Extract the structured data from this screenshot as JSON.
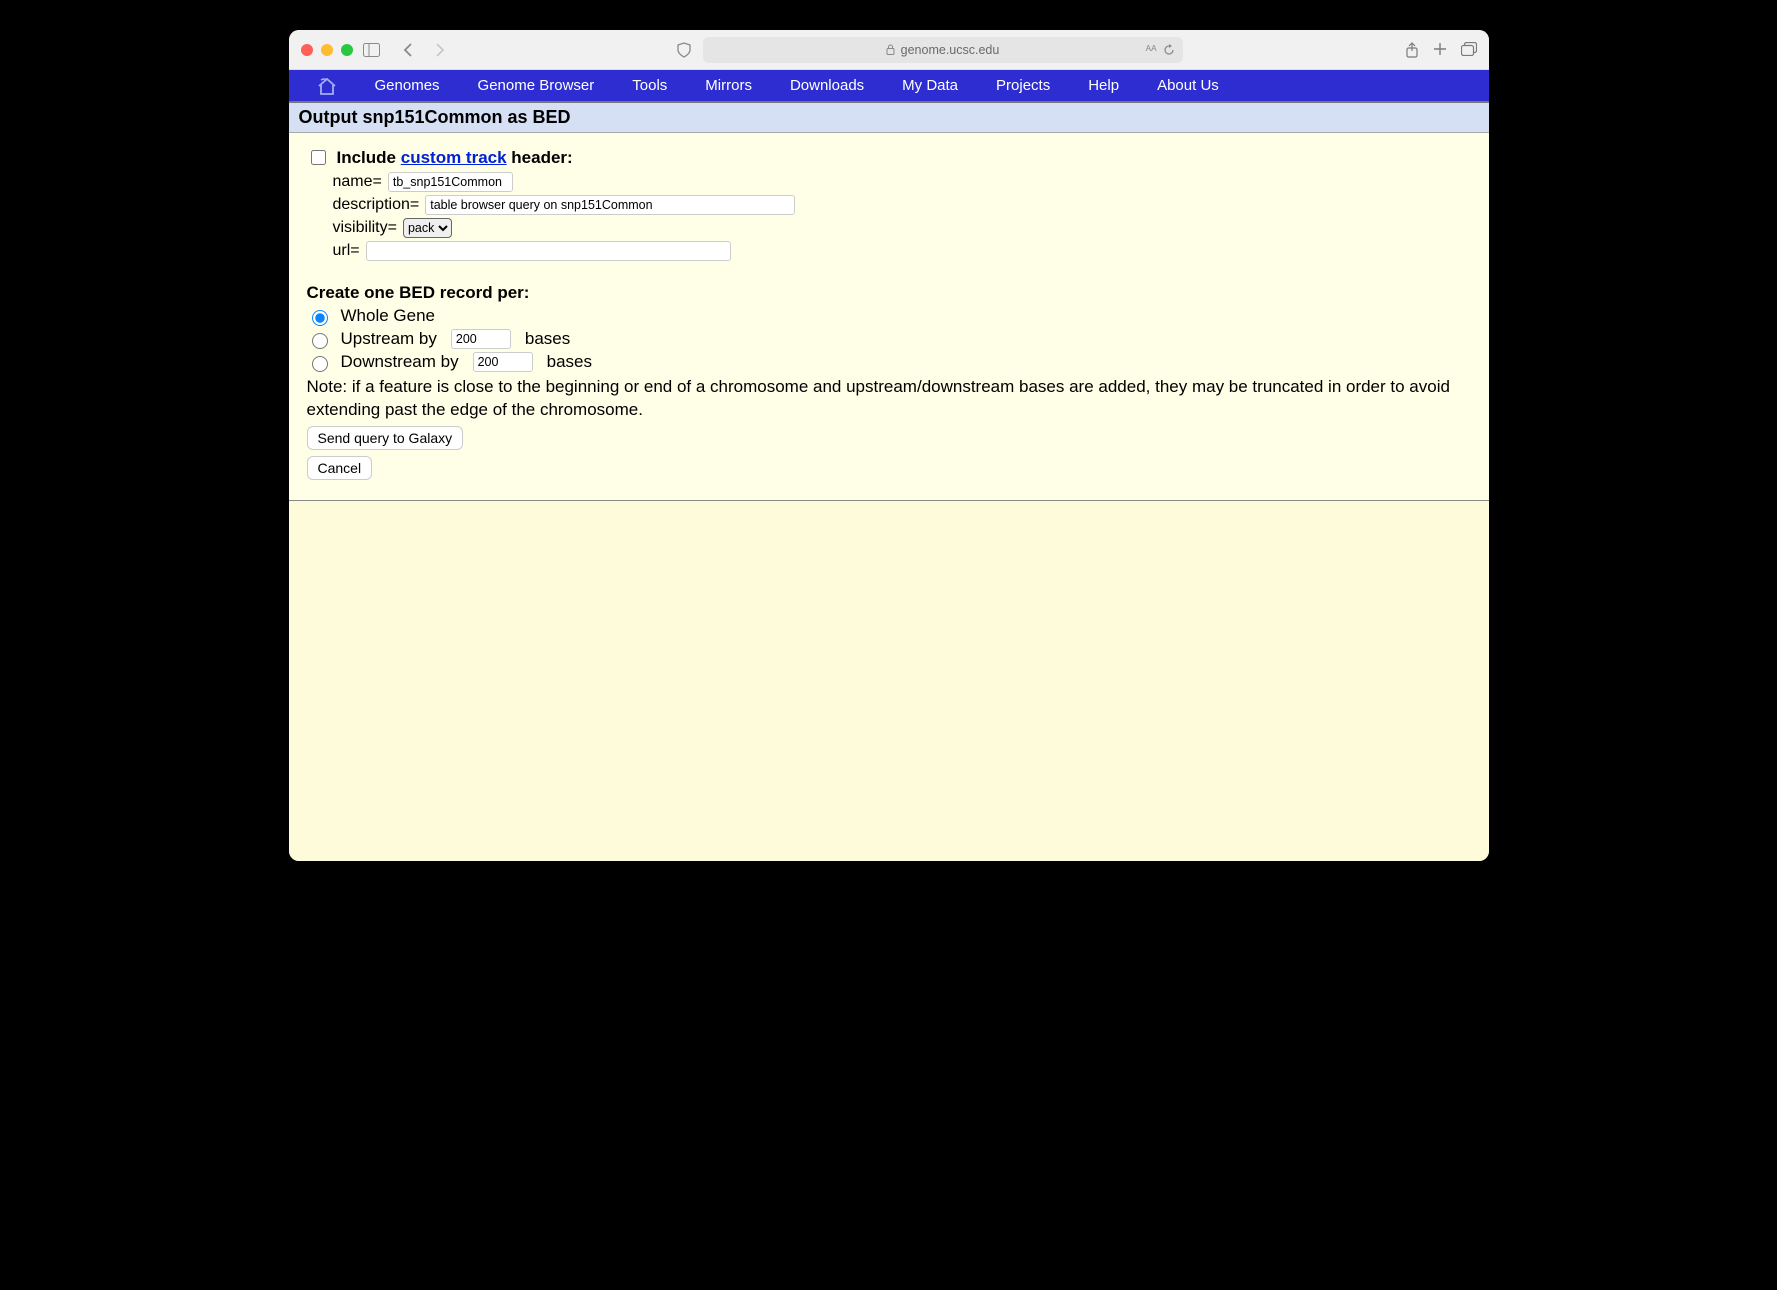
{
  "browser": {
    "address": "genome.ucsc.edu"
  },
  "nav": {
    "items": [
      "Genomes",
      "Genome Browser",
      "Tools",
      "Mirrors",
      "Downloads",
      "My Data",
      "Projects",
      "Help",
      "About Us"
    ]
  },
  "page": {
    "title": "Output snp151Common as BED",
    "include_header_prefix": "Include ",
    "include_header_link": "custom track",
    "include_header_suffix": " header:",
    "name_label": "name=",
    "name_value": "tb_snp151Common",
    "description_label": "description=",
    "description_value": "table browser query on snp151Common",
    "visibility_label": "visibility=",
    "visibility_value": "pack",
    "url_label": "url=",
    "url_value": "",
    "section2_title": "Create one BED record per:",
    "radio_whole": "Whole Gene",
    "radio_up_prefix": "Upstream by",
    "radio_up_value": "200",
    "radio_up_suffix": "bases",
    "radio_down_prefix": "Downstream by",
    "radio_down_value": "200",
    "radio_down_suffix": "bases",
    "note": "Note: if a feature is close to the beginning or end of a chromosome and upstream/downstream bases are added, they may be truncated in order to avoid extending past the edge of the chromosome.",
    "submit_label": "Send query to Galaxy",
    "cancel_label": "Cancel"
  }
}
